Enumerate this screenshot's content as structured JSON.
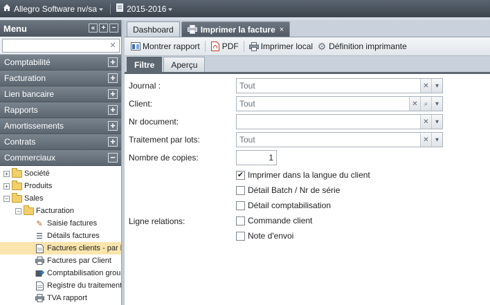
{
  "topbar": {
    "company": "Allegro Software nv/sa",
    "year": "2015-2016"
  },
  "menu": {
    "title": "Menu",
    "search_placeholder": "",
    "sections": [
      {
        "label": "Comptabilité",
        "toggle": "+"
      },
      {
        "label": "Facturation",
        "toggle": "+"
      },
      {
        "label": "Lien bancaire",
        "toggle": "+"
      },
      {
        "label": "Rapports",
        "toggle": "+"
      },
      {
        "label": "Amortissements",
        "toggle": "+"
      },
      {
        "label": "Contrats",
        "toggle": "+"
      },
      {
        "label": "Commerciaux",
        "toggle": "−"
      }
    ],
    "tree": {
      "societe": "Société",
      "produits": "Produits",
      "sales": "Sales",
      "facturation": "Facturation",
      "saisie": "Saisie factures",
      "details": "Détails factures",
      "factures_clients": "Factures clients - par lot",
      "factures_par_client": "Factures par Client",
      "comptabilisation": "Comptabilisation groupée",
      "registre": "Registre du traitement",
      "tva": "TVA rapport"
    }
  },
  "tabs": {
    "dashboard": "Dashboard",
    "active": "Imprimer la facture",
    "close": "×"
  },
  "toolbar": {
    "montrer": "Montrer rapport",
    "pdf": "PDF",
    "imprimer_local": "Imprimer local",
    "definition": "Définition imprimante"
  },
  "subtabs": {
    "filtre": "Filtre",
    "apercu": "Aperçu"
  },
  "form": {
    "journal_label": "Journal :",
    "journal_value": "Tout",
    "client_label": "Client:",
    "client_value": "Tout",
    "nrdoc_label": "Nr document:",
    "nrdoc_value": "",
    "traitement_label": "Traitement par lots:",
    "traitement_value": "Tout",
    "copies_label": "Nombre de copies:",
    "copies_value": "1",
    "ligne_label": "Ligne relations:",
    "checks": [
      {
        "label": "Imprimer dans la langue du client",
        "checked": true
      },
      {
        "label": "Détail Batch / Nr de série",
        "checked": false
      },
      {
        "label": "Détail comptabilisation",
        "checked": false
      },
      {
        "label": "Commande client",
        "checked": false
      },
      {
        "label": "Note d'envoi",
        "checked": false
      }
    ]
  }
}
